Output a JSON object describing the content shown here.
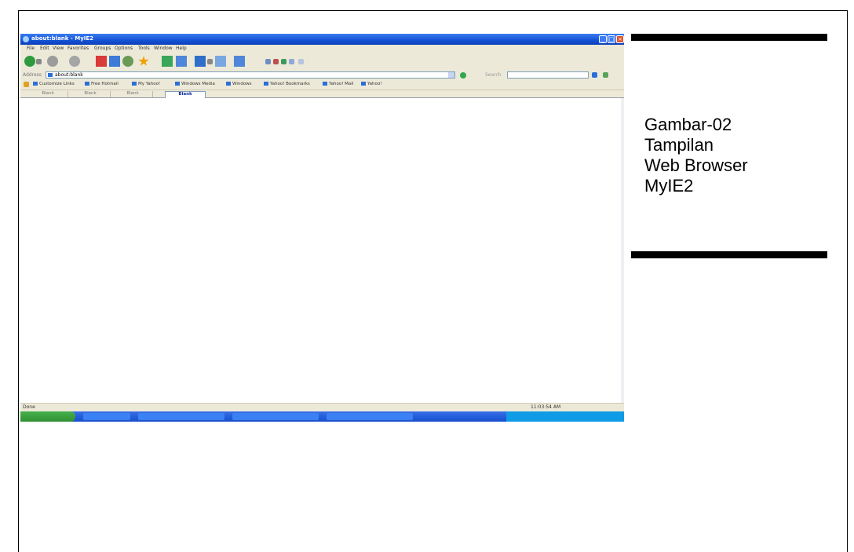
{
  "browser": {
    "window_title": "about:blank - MyIE2",
    "menu": [
      "File",
      "Edit",
      "View",
      "Favorites",
      "Groups",
      "Options",
      "Tools",
      "Window",
      "Help"
    ],
    "address_label": "Address",
    "address_value": "about:blank",
    "search_label": "Search",
    "links": [
      "Customize Links",
      "Free Hotmail",
      "My Yahoo!",
      "Windows Media",
      "Windows",
      "Yahoo! Bookmarks",
      "Yahoo! Mail",
      "Yahoo!"
    ],
    "tabs": [
      {
        "label": "Blank",
        "active": false
      },
      {
        "label": "Blank",
        "active": false
      },
      {
        "label": "Blank",
        "active": false
      },
      {
        "label": "Blank",
        "active": true
      }
    ],
    "status_text": "Done",
    "status_clock": "11:03:54 AM"
  },
  "caption": {
    "line1": "Gambar-02",
    "line2": "Tampilan",
    "line3": "Web Browser",
    "line4": "MyIE2"
  }
}
